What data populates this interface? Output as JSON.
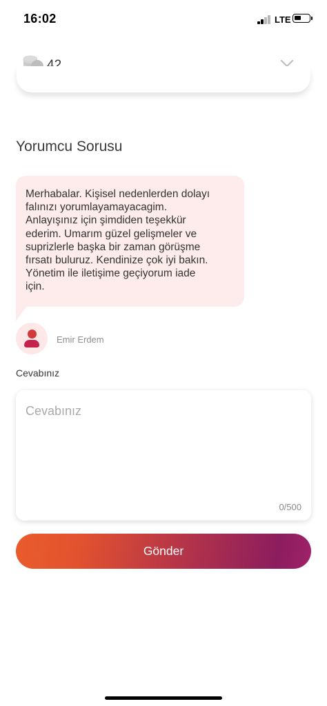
{
  "status_bar": {
    "time": "16:02",
    "network": "LTE"
  },
  "header": {
    "coin_count": "42"
  },
  "section": {
    "title": "Yorumcu Sorusu"
  },
  "message": {
    "text": "Merhabalar.  Kişisel nedenlerden dolayı\nfalınızı yorumlayamayacagim.\nAnlayışınız için şimdiden teşekkür\nederim.  Umarım güzel gelişmeler ve\nsuprizlerle başka bir zaman görüşme\nfırsatı buluruz.   Kendinize çok iyi bakın.\nYönetim ile iletişime geçiyorum iade\niçin.",
    "author": "Emir Erdem"
  },
  "answer": {
    "label": "Cevabınız",
    "placeholder": "Cevabınız",
    "value": "",
    "counter": "0/500"
  },
  "send_button": {
    "label": "Gönder"
  },
  "colors": {
    "bubble": "#fdeceb",
    "gradient_start": "#ea5c2c",
    "gradient_end": "#8c1d5e"
  }
}
